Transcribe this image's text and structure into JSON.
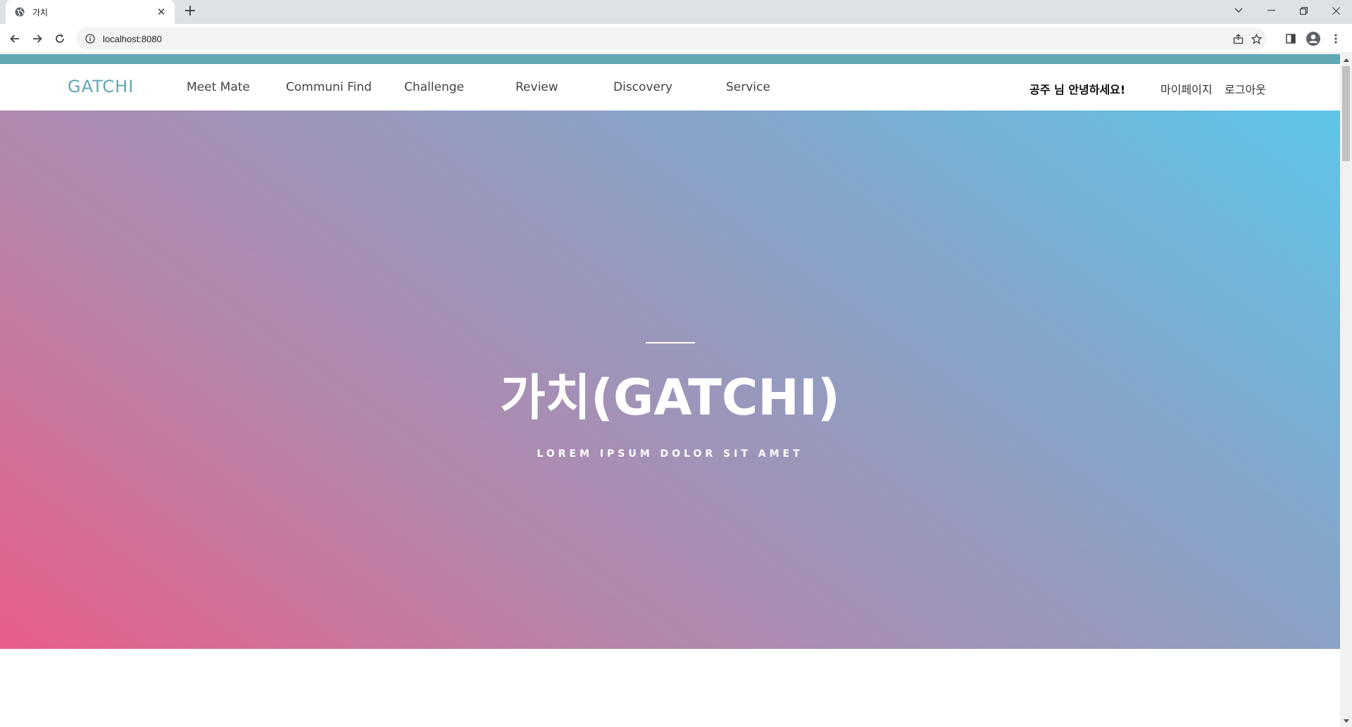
{
  "browser": {
    "tab_title": "가치",
    "new_tab_label": "+",
    "url": "localhost:8080"
  },
  "site": {
    "logo": "GATCHI",
    "menu": [
      "Meet Mate",
      "Communi Find",
      "Challenge",
      "Review",
      "Discovery",
      "Service"
    ],
    "greeting": "공주 님 안녕하세요!",
    "mypage_label": "마이페이지",
    "logout_label": "로그아웃"
  },
  "hero": {
    "title": "가치(GATCHI)",
    "subtitle": "LOREM IPSUM DOLOR SIT AMET"
  },
  "colors": {
    "accent": "#5fa8b4",
    "gradient_start": "#e85d8a",
    "gradient_end": "#5ec6e8"
  }
}
